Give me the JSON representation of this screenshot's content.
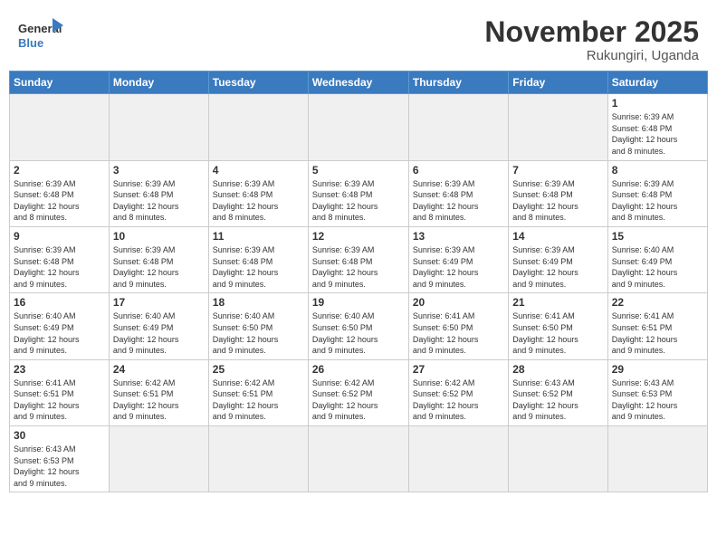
{
  "header": {
    "logo_general": "General",
    "logo_blue": "Blue",
    "month_title": "November 2025",
    "location": "Rukungiri, Uganda"
  },
  "days_of_week": [
    "Sunday",
    "Monday",
    "Tuesday",
    "Wednesday",
    "Thursday",
    "Friday",
    "Saturday"
  ],
  "weeks": [
    [
      {
        "day": "",
        "info": ""
      },
      {
        "day": "",
        "info": ""
      },
      {
        "day": "",
        "info": ""
      },
      {
        "day": "",
        "info": ""
      },
      {
        "day": "",
        "info": ""
      },
      {
        "day": "",
        "info": ""
      },
      {
        "day": "1",
        "info": "Sunrise: 6:39 AM\nSunset: 6:48 PM\nDaylight: 12 hours\nand 8 minutes."
      }
    ],
    [
      {
        "day": "2",
        "info": "Sunrise: 6:39 AM\nSunset: 6:48 PM\nDaylight: 12 hours\nand 8 minutes."
      },
      {
        "day": "3",
        "info": "Sunrise: 6:39 AM\nSunset: 6:48 PM\nDaylight: 12 hours\nand 8 minutes."
      },
      {
        "day": "4",
        "info": "Sunrise: 6:39 AM\nSunset: 6:48 PM\nDaylight: 12 hours\nand 8 minutes."
      },
      {
        "day": "5",
        "info": "Sunrise: 6:39 AM\nSunset: 6:48 PM\nDaylight: 12 hours\nand 8 minutes."
      },
      {
        "day": "6",
        "info": "Sunrise: 6:39 AM\nSunset: 6:48 PM\nDaylight: 12 hours\nand 8 minutes."
      },
      {
        "day": "7",
        "info": "Sunrise: 6:39 AM\nSunset: 6:48 PM\nDaylight: 12 hours\nand 8 minutes."
      },
      {
        "day": "8",
        "info": "Sunrise: 6:39 AM\nSunset: 6:48 PM\nDaylight: 12 hours\nand 8 minutes."
      }
    ],
    [
      {
        "day": "9",
        "info": "Sunrise: 6:39 AM\nSunset: 6:48 PM\nDaylight: 12 hours\nand 9 minutes."
      },
      {
        "day": "10",
        "info": "Sunrise: 6:39 AM\nSunset: 6:48 PM\nDaylight: 12 hours\nand 9 minutes."
      },
      {
        "day": "11",
        "info": "Sunrise: 6:39 AM\nSunset: 6:48 PM\nDaylight: 12 hours\nand 9 minutes."
      },
      {
        "day": "12",
        "info": "Sunrise: 6:39 AM\nSunset: 6:48 PM\nDaylight: 12 hours\nand 9 minutes."
      },
      {
        "day": "13",
        "info": "Sunrise: 6:39 AM\nSunset: 6:49 PM\nDaylight: 12 hours\nand 9 minutes."
      },
      {
        "day": "14",
        "info": "Sunrise: 6:39 AM\nSunset: 6:49 PM\nDaylight: 12 hours\nand 9 minutes."
      },
      {
        "day": "15",
        "info": "Sunrise: 6:40 AM\nSunset: 6:49 PM\nDaylight: 12 hours\nand 9 minutes."
      }
    ],
    [
      {
        "day": "16",
        "info": "Sunrise: 6:40 AM\nSunset: 6:49 PM\nDaylight: 12 hours\nand 9 minutes."
      },
      {
        "day": "17",
        "info": "Sunrise: 6:40 AM\nSunset: 6:49 PM\nDaylight: 12 hours\nand 9 minutes."
      },
      {
        "day": "18",
        "info": "Sunrise: 6:40 AM\nSunset: 6:50 PM\nDaylight: 12 hours\nand 9 minutes."
      },
      {
        "day": "19",
        "info": "Sunrise: 6:40 AM\nSunset: 6:50 PM\nDaylight: 12 hours\nand 9 minutes."
      },
      {
        "day": "20",
        "info": "Sunrise: 6:41 AM\nSunset: 6:50 PM\nDaylight: 12 hours\nand 9 minutes."
      },
      {
        "day": "21",
        "info": "Sunrise: 6:41 AM\nSunset: 6:50 PM\nDaylight: 12 hours\nand 9 minutes."
      },
      {
        "day": "22",
        "info": "Sunrise: 6:41 AM\nSunset: 6:51 PM\nDaylight: 12 hours\nand 9 minutes."
      }
    ],
    [
      {
        "day": "23",
        "info": "Sunrise: 6:41 AM\nSunset: 6:51 PM\nDaylight: 12 hours\nand 9 minutes."
      },
      {
        "day": "24",
        "info": "Sunrise: 6:42 AM\nSunset: 6:51 PM\nDaylight: 12 hours\nand 9 minutes."
      },
      {
        "day": "25",
        "info": "Sunrise: 6:42 AM\nSunset: 6:51 PM\nDaylight: 12 hours\nand 9 minutes."
      },
      {
        "day": "26",
        "info": "Sunrise: 6:42 AM\nSunset: 6:52 PM\nDaylight: 12 hours\nand 9 minutes."
      },
      {
        "day": "27",
        "info": "Sunrise: 6:42 AM\nSunset: 6:52 PM\nDaylight: 12 hours\nand 9 minutes."
      },
      {
        "day": "28",
        "info": "Sunrise: 6:43 AM\nSunset: 6:52 PM\nDaylight: 12 hours\nand 9 minutes."
      },
      {
        "day": "29",
        "info": "Sunrise: 6:43 AM\nSunset: 6:53 PM\nDaylight: 12 hours\nand 9 minutes."
      }
    ],
    [
      {
        "day": "30",
        "info": "Sunrise: 6:43 AM\nSunset: 6:53 PM\nDaylight: 12 hours\nand 9 minutes."
      },
      {
        "day": "",
        "info": ""
      },
      {
        "day": "",
        "info": ""
      },
      {
        "day": "",
        "info": ""
      },
      {
        "day": "",
        "info": ""
      },
      {
        "day": "",
        "info": ""
      },
      {
        "day": "",
        "info": ""
      }
    ]
  ]
}
